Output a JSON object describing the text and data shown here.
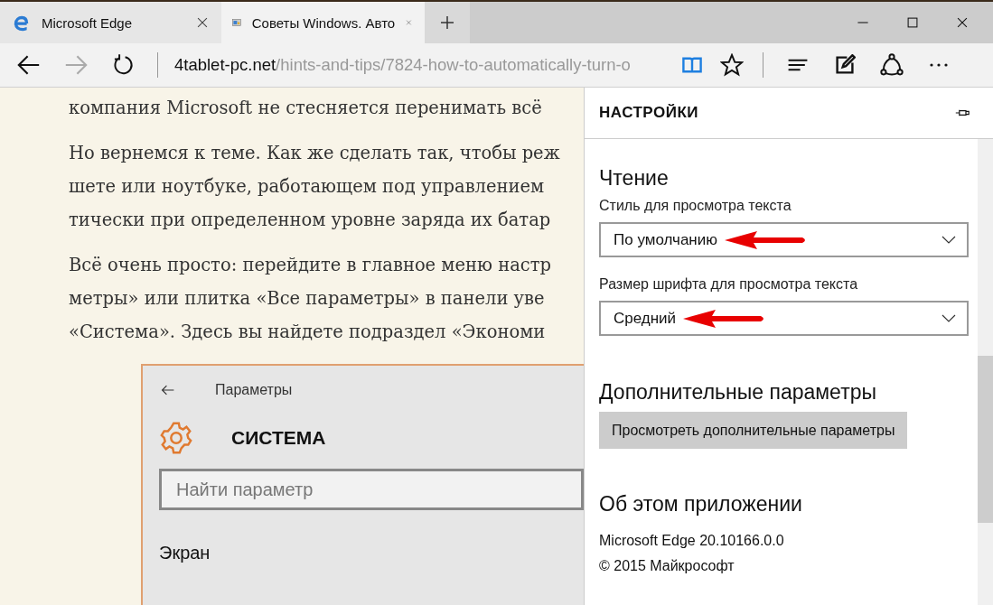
{
  "tabs": [
    {
      "kind": "edge",
      "label": "Microsoft Edge",
      "selected": false
    },
    {
      "kind": "page",
      "label": "Советы Windows. Авто",
      "selected": true
    }
  ],
  "address": {
    "domain": "4tablet-pc.net",
    "path": "/hints-and-tips/7824-how-to-automatically-turn-o"
  },
  "toolbar": {
    "reading_view_on": true,
    "forward_disabled": true
  },
  "article": {
    "paragraphs": [
      [
        "компания Microsoft не стесняется перенимать всё"
      ],
      [
        "Но вернемся к теме. Как же сделать так, чтобы реж",
        "шете или ноутбуке, работающем под управлением",
        "тически при определенном уровне заряда их батар"
      ],
      [
        "Всё очень просто: перейдите в главное меню настр",
        "метры» или плитка «Все параметры» в панели уве",
        "«Система». Здесь вы найдете подраздел «Экономи"
      ]
    ],
    "embedded": {
      "title": "Параметры",
      "heading": "СИСТЕМА",
      "search_placeholder": "Найти параметр",
      "first_item": "Экран"
    }
  },
  "settings": {
    "title": "НАСТРОЙКИ",
    "reading": {
      "heading": "Чтение",
      "fields": [
        {
          "label": "Стиль для просмотра текста",
          "value": "По умолчанию",
          "annotated": true
        },
        {
          "label": "Размер шрифта для просмотра текста",
          "value": "Средний",
          "annotated": true
        }
      ]
    },
    "advanced": {
      "heading": "Дополнительные параметры",
      "button": "Просмотреть дополнительные параметры"
    },
    "about": {
      "heading": "Об этом приложении",
      "lines": [
        "Microsoft Edge 20.10166.0.0",
        "© 2015 Майкрософт"
      ]
    }
  }
}
